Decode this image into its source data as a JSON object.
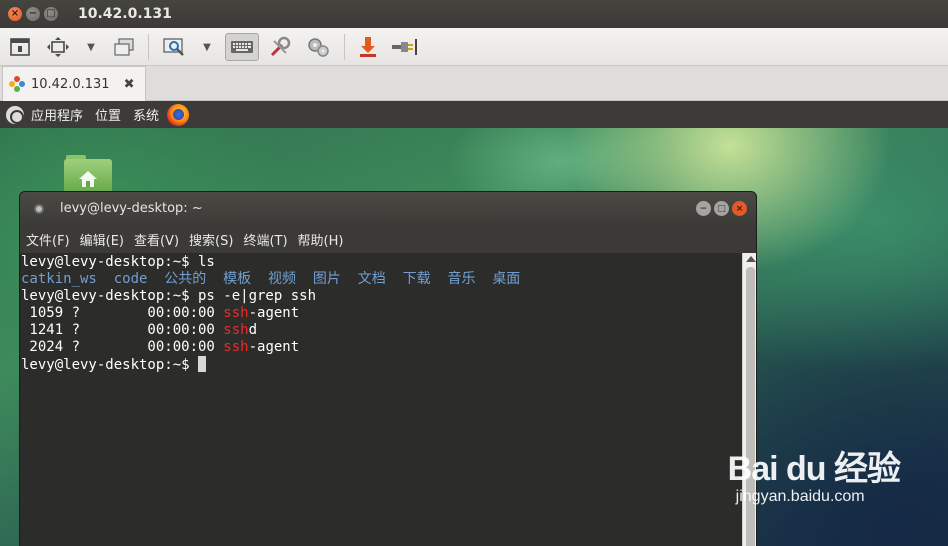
{
  "window": {
    "title": "10.42.0.131"
  },
  "tab": {
    "label": "10.42.0.131"
  },
  "toolbar": {
    "items": [
      "fullscreen-icon",
      "resize-icon",
      "chevron-down-icon",
      "windows-icon",
      "zoom-icon",
      "chevron-down-icon",
      "keyboard-icon",
      "tools-icon",
      "settings-icon",
      "download-icon",
      "plug-icon"
    ]
  },
  "panel": {
    "menu_apps": "应用程序",
    "menu_places": "位置",
    "menu_system": "系统"
  },
  "terminal": {
    "title": "levy@levy-desktop: ~",
    "menu": [
      "文件(F)",
      "编辑(E)",
      "查看(V)",
      "搜索(S)",
      "终端(T)",
      "帮助(H)"
    ],
    "prompt": "levy@levy-desktop:~$",
    "cmd1": " ls",
    "ls_items": [
      "catkin_ws",
      "code",
      "公共的",
      "模板",
      "视频",
      "图片",
      "文档",
      "下载",
      "音乐",
      "桌面"
    ],
    "cmd2": " ps -e|grep ssh",
    "procs": [
      {
        "pid": " 1059 ?        00:00:00 ",
        "match": "ssh",
        "rest": "-agent"
      },
      {
        "pid": " 1241 ?        00:00:00 ",
        "match": "ssh",
        "rest": "d"
      },
      {
        "pid": " 2024 ?        00:00:00 ",
        "match": "ssh",
        "rest": "-agent"
      }
    ]
  },
  "watermark": {
    "brand": "Bai du 经验",
    "url": "jingyan.baidu.com"
  },
  "colors": {
    "ls_dir": "#729fcf",
    "grep_match": "#ef2929",
    "close_button": "#e2592b"
  }
}
